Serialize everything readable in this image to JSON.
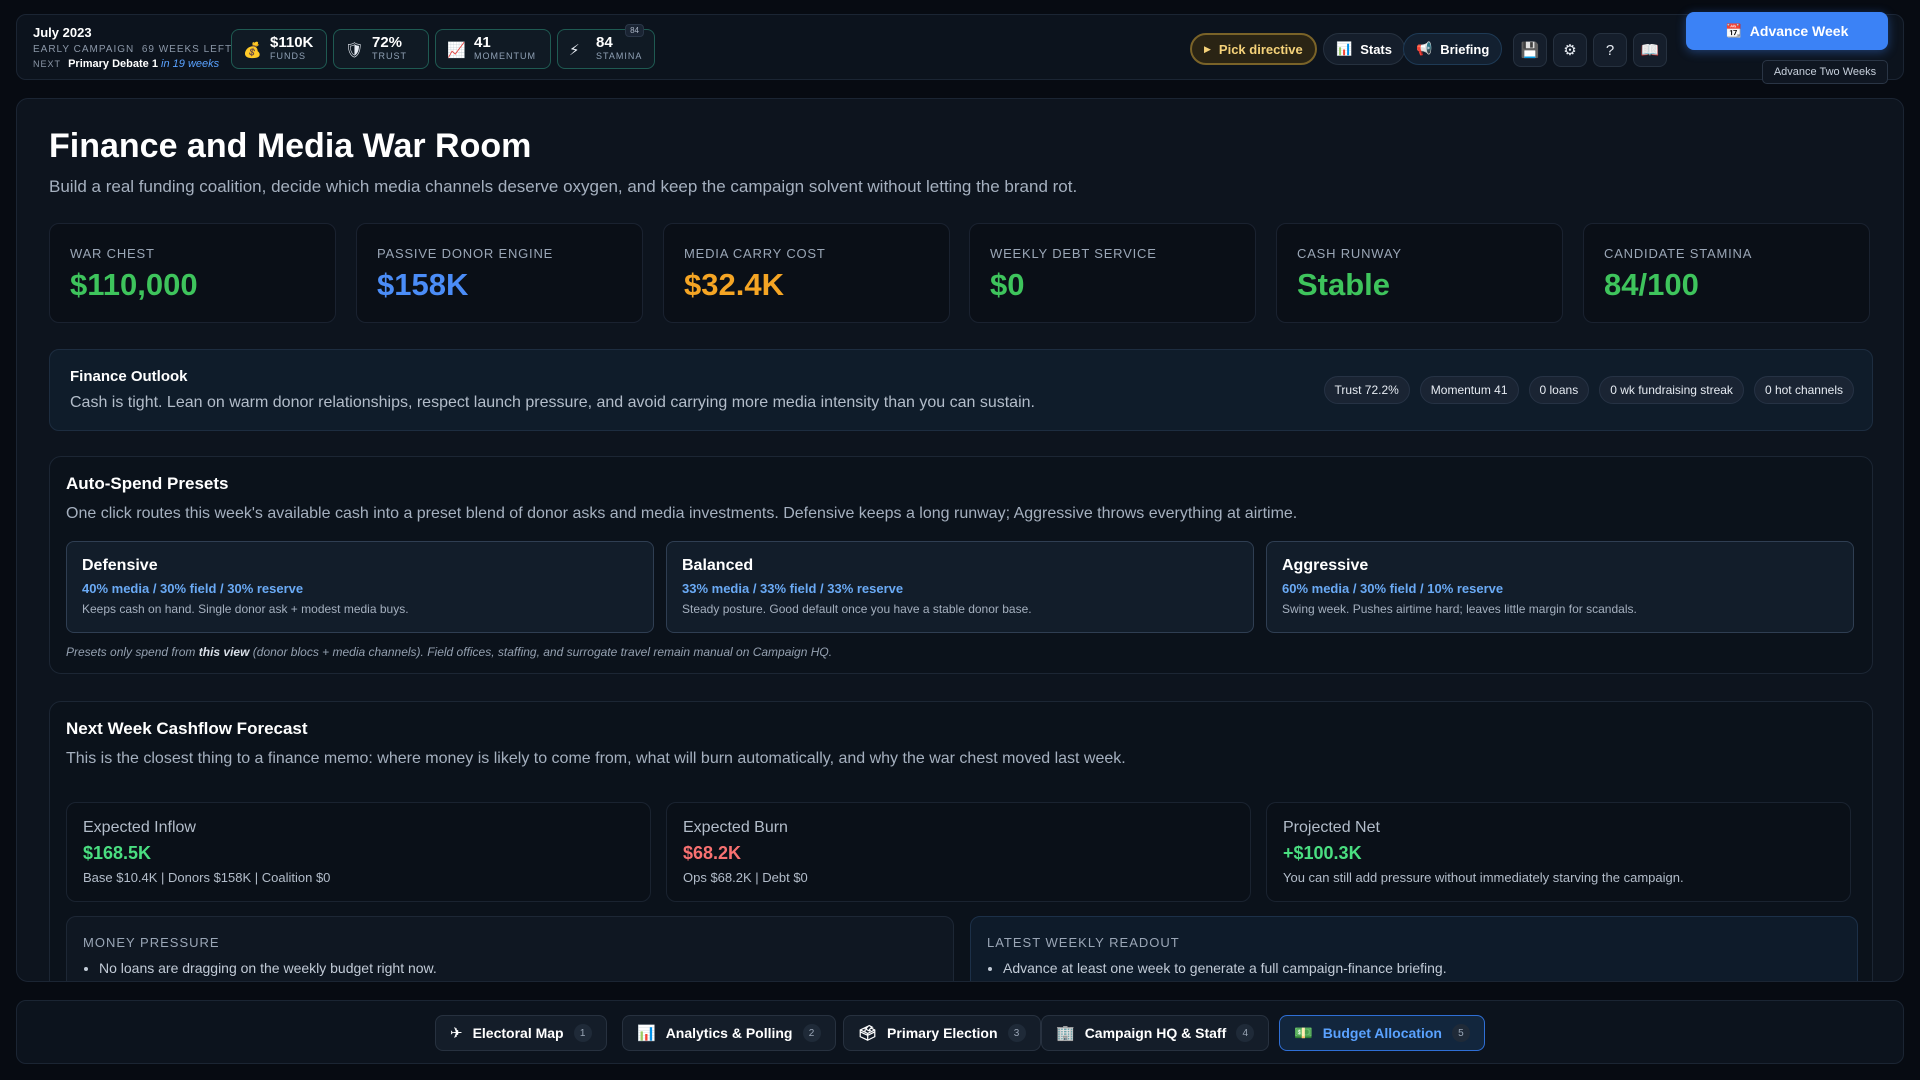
{
  "topbar": {
    "date": "July 2023",
    "phase": "Early Campaign",
    "weeks_left": "69 weeks left",
    "next_label": "NEXT",
    "next_event": "Primary Debate 1",
    "next_when": "in 19 weeks",
    "stats": [
      {
        "icon": "money-bag-icon",
        "value": "$110K",
        "label": "Funds"
      },
      {
        "icon": "shield-icon",
        "value": "72%",
        "label": "Trust"
      },
      {
        "icon": "chart-icon",
        "value": "41",
        "label": "Momentum"
      },
      {
        "icon": "lightning-icon",
        "value": "84",
        "label": "Stamina",
        "badge": "84"
      }
    ],
    "pick_directive": "Pick directive",
    "stats_button": "Stats",
    "briefing_button": "Briefing",
    "advance_week": "Advance Week",
    "advance_two_weeks": "Advance Two Weeks",
    "help_glyph": "?"
  },
  "page": {
    "title": "Finance and Media War Room",
    "subtitle": "Build a real funding coalition, decide which media channels deserve oxygen, and keep the campaign solvent without letting the brand rot."
  },
  "kpis": [
    {
      "label": "War Chest",
      "value": "$110,000",
      "color": "#3ec45c"
    },
    {
      "label": "Passive Donor Engine",
      "value": "$158K",
      "color": "#4b8df8"
    },
    {
      "label": "Media Carry Cost",
      "value": "$32.4K",
      "color": "#f5a524"
    },
    {
      "label": "Weekly Debt Service",
      "value": "$0",
      "color": "#3ec45c"
    },
    {
      "label": "Cash Runway",
      "value": "Stable",
      "color": "#3ec45c"
    },
    {
      "label": "Candidate Stamina",
      "value": "84/100",
      "color": "#3ec45c"
    }
  ],
  "outlook": {
    "title": "Finance Outlook",
    "text": "Cash is tight. Lean on warm donor relationships, respect launch pressure, and avoid carrying more media intensity than you can sustain.",
    "chips": [
      "Trust 72.2%",
      "Momentum 41",
      "0 loans",
      "0 wk fundraising streak",
      "0 hot channels"
    ]
  },
  "presets": {
    "title": "Auto-Spend Presets",
    "description": "One click routes this week's available cash into a preset blend of donor asks and media investments. Defensive keeps a long runway; Aggressive throws everything at airtime.",
    "items": [
      {
        "name": "Defensive",
        "mix": "40% media / 30% field / 30% reserve",
        "desc": "Keeps cash on hand. Single donor ask + modest media buys."
      },
      {
        "name": "Balanced",
        "mix": "33% media / 33% field / 33% reserve",
        "desc": "Steady posture. Good default once you have a stable donor base."
      },
      {
        "name": "Aggressive",
        "mix": "60% media / 30% field / 10% reserve",
        "desc": "Swing week. Pushes airtime hard; leaves little margin for scandals."
      }
    ],
    "note_prefix": "Presets only spend from",
    "note_bold": "this view",
    "note_suffix": "(donor blocs + media channels). Field offices, staffing, and surrogate travel remain manual on Campaign HQ."
  },
  "forecast": {
    "title": "Next Week Cashflow Forecast",
    "description": "This is the closest thing to a finance memo: where money is likely to come from, what will burn automatically, and why the war chest moved last week.",
    "cards": [
      {
        "label": "Expected Inflow",
        "value": "$168.5K",
        "detail": "Base $10.4K | Donors $158K | Coalition $0",
        "color": "#4ade80"
      },
      {
        "label": "Expected Burn",
        "value": "$68.2K",
        "detail": "Ops $68.2K | Debt $0",
        "color": "#f87171"
      },
      {
        "label": "Projected Net",
        "value": "+$100.3K",
        "detail": "You can still add pressure without immediately starving the campaign.",
        "color": "#4ade80"
      }
    ],
    "money_pressure": {
      "label": "Money Pressure",
      "items": [
        "No loans are dragging on the weekly budget right now."
      ]
    },
    "weekly_readout": {
      "label": "Latest Weekly Readout",
      "items": [
        "Advance at least one week to generate a full campaign-finance briefing."
      ]
    }
  },
  "nav": [
    {
      "icon": "plane-icon",
      "label": "Electoral Map",
      "num": "1"
    },
    {
      "icon": "bar-chart-icon",
      "label": "Analytics & Polling",
      "num": "2"
    },
    {
      "icon": "ballot-box-icon",
      "label": "Primary Election",
      "num": "3"
    },
    {
      "icon": "building-icon",
      "label": "Campaign HQ & Staff",
      "num": "4"
    },
    {
      "icon": "cash-icon",
      "label": "Budget Allocation",
      "num": "5",
      "active": true
    }
  ]
}
